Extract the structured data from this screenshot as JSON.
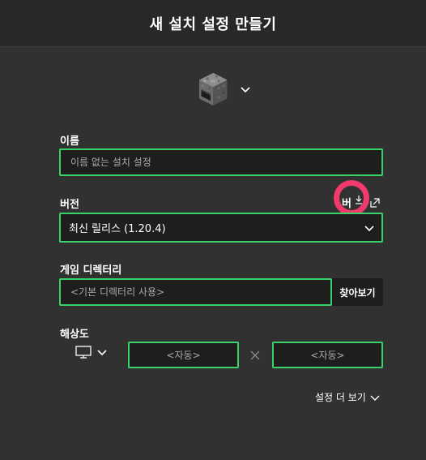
{
  "dialog": {
    "title": "새 설치 설정 만들기"
  },
  "icon_picker": {
    "icon": "furnace-icon"
  },
  "name_section": {
    "label": "이름",
    "placeholder": "이름 없는 설치 설정",
    "value": ""
  },
  "version_section": {
    "label": "버전",
    "selected": "최신 릴리스 (1.20.4)",
    "overlay_text": "버",
    "icons": [
      "download-icon",
      "external-link-icon"
    ]
  },
  "game_dir_section": {
    "label": "게임 디렉터리",
    "placeholder": "<기본 디렉터리 사용>",
    "browse_label": "찾아보기"
  },
  "resolution_section": {
    "label": "해상도",
    "width_placeholder": "<자동>",
    "height_placeholder": "<자동>",
    "display_icon": "monitor-icon"
  },
  "more_settings": {
    "label": "설정 더 보기"
  },
  "colors": {
    "accent": "#3ad16b",
    "background": "#313131",
    "header": "#282828",
    "field_bg": "#1e1e1e",
    "highlight_ring": "#f03a6b"
  }
}
